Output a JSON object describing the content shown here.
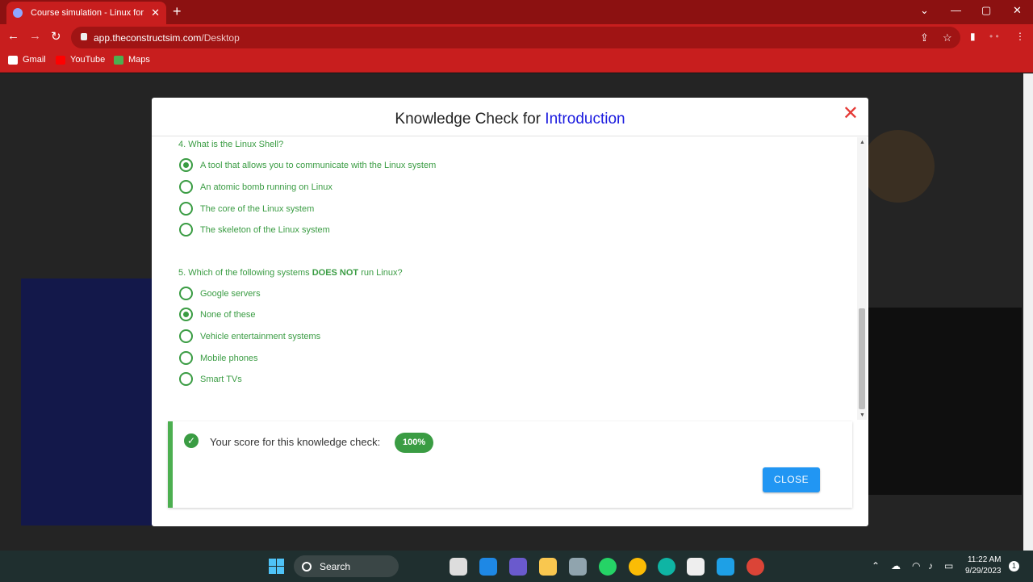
{
  "browser": {
    "tab_title": "Course simulation - Linux for Ro",
    "url_host": "app.theconstructsim.com",
    "url_path": "/Desktop",
    "bookmarks": [
      "Gmail",
      "YouTube",
      "Maps"
    ]
  },
  "modal": {
    "title_prefix": "Knowledge Check for ",
    "title_accent": "Introduction",
    "questions": [
      {
        "text": "4. What is the Linux Shell?",
        "options": [
          {
            "label": "A tool that allows you to communicate with the Linux system",
            "selected": true
          },
          {
            "label": "An atomic bomb running on Linux",
            "selected": false
          },
          {
            "label": "The core of the Linux system",
            "selected": false
          },
          {
            "label": "The skeleton of the Linux system",
            "selected": false
          }
        ]
      },
      {
        "text_before": "5. Which of the following systems ",
        "text_bold": "DOES NOT",
        "text_after": " run Linux?",
        "options": [
          {
            "label": "Google servers",
            "selected": false
          },
          {
            "label": "None of these",
            "selected": true
          },
          {
            "label": "Vehicle entertainment systems",
            "selected": false
          },
          {
            "label": "Mobile phones",
            "selected": false
          },
          {
            "label": "Smart TVs",
            "selected": false
          }
        ]
      }
    ],
    "score_label": "Your score for this knowledge check:",
    "score_value": "100%",
    "close_label": "CLOSE"
  },
  "taskbar": {
    "search_label": "Search",
    "time": "11:22 AM",
    "date": "9/29/2023",
    "notification_count": "1"
  },
  "colors": {
    "chrome": "#c81e1e",
    "accent_green": "#3a9c43",
    "title_accent": "#1a1adf",
    "close_button": "#2196f3"
  }
}
